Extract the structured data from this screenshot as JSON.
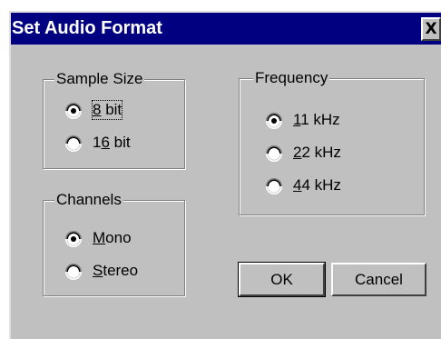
{
  "dialog": {
    "title": "Set Audio Format",
    "close_label": "X"
  },
  "sample_size": {
    "label": "Sample Size",
    "options": [
      {
        "pre": "",
        "mnemonic": "8",
        "post": " bit",
        "selected": true
      },
      {
        "pre": "1",
        "mnemonic": "6",
        "post": " bit",
        "selected": false
      }
    ]
  },
  "channels": {
    "label": "Channels",
    "options": [
      {
        "pre": "",
        "mnemonic": "M",
        "post": "ono",
        "selected": true
      },
      {
        "pre": "",
        "mnemonic": "S",
        "post": "tereo",
        "selected": false
      }
    ]
  },
  "frequency": {
    "label": "Frequency",
    "options": [
      {
        "pre": "",
        "mnemonic": "1",
        "post": "1 kHz",
        "selected": true
      },
      {
        "pre": "",
        "mnemonic": "2",
        "post": "2 kHz",
        "selected": false
      },
      {
        "pre": "",
        "mnemonic": "4",
        "post": "4 kHz",
        "selected": false
      }
    ]
  },
  "buttons": {
    "ok": "OK",
    "cancel": "Cancel"
  },
  "colors": {
    "face": "#c0c0c0",
    "title_bar": "#000080",
    "title_text": "#ffffff",
    "shadow": "#808080",
    "highlight": "#ffffff"
  }
}
